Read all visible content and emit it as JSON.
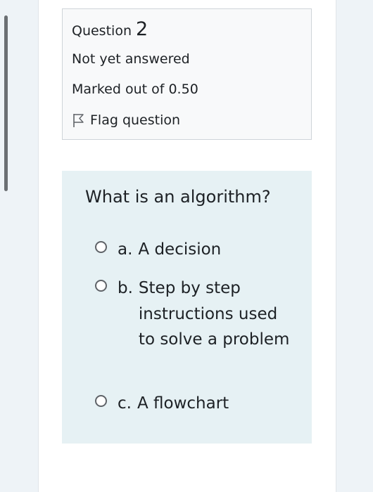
{
  "question_info": {
    "label": "Question",
    "number": "2",
    "state": "Not yet answered",
    "grade": "Marked out of 0.50",
    "flag_label": "Flag question",
    "flag_icon": "flag-icon"
  },
  "question": {
    "text": "What is an algorithm?",
    "options": [
      {
        "letter": "a.",
        "text": "A decision",
        "selected": false
      },
      {
        "letter": "b.",
        "text": "Step by step instructions used to solve a problem",
        "selected": false
      },
      {
        "letter": "c.",
        "text": "A flowchart",
        "selected": false
      }
    ]
  },
  "colors": {
    "page_background": "#eef3f7",
    "info_box_background": "#f8f9fa",
    "formulation_background": "#e6f1f4",
    "text": "#1d2125"
  }
}
